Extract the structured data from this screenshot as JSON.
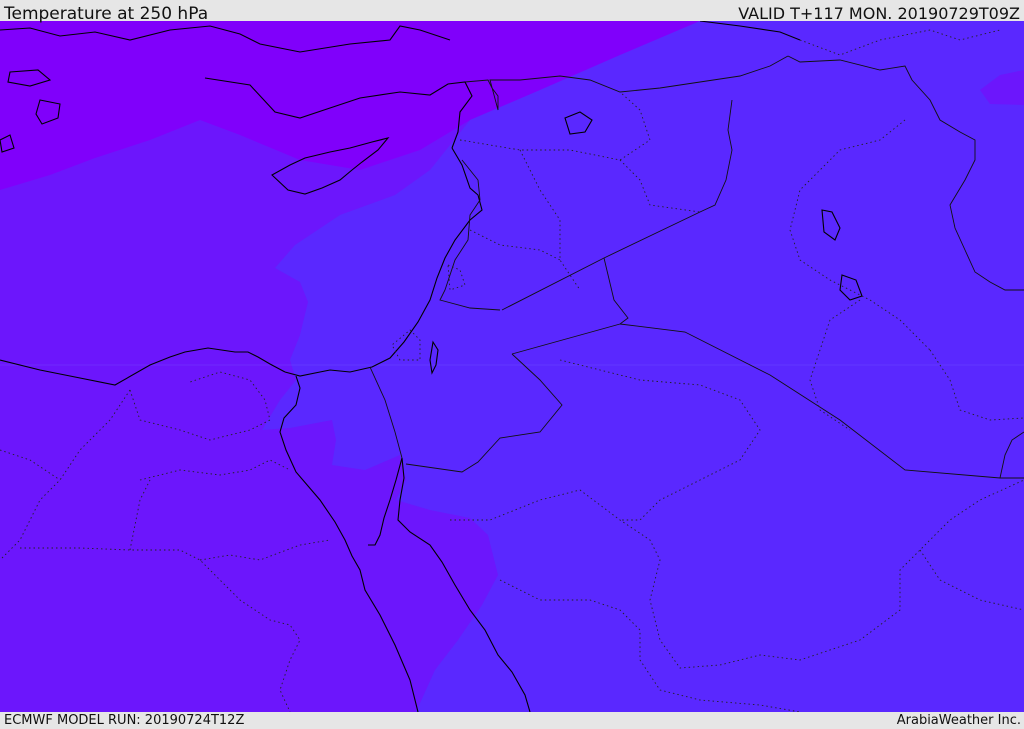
{
  "header": {
    "title": "Temperature at 250 hPa",
    "valid_time": "VALID T+117 MON. 20190729T09Z"
  },
  "footer": {
    "model_run": "ECMWF MODEL RUN: 20190724T12Z",
    "provider": "ArabiaWeather Inc."
  },
  "map": {
    "variable": "temperature",
    "pressure_level_hpa": 250,
    "colors": {
      "coldest": "#8000fb",
      "cold": "#6c16fc",
      "cool": "#5a28ff",
      "coastline": "#000000",
      "border": "#111111"
    }
  }
}
